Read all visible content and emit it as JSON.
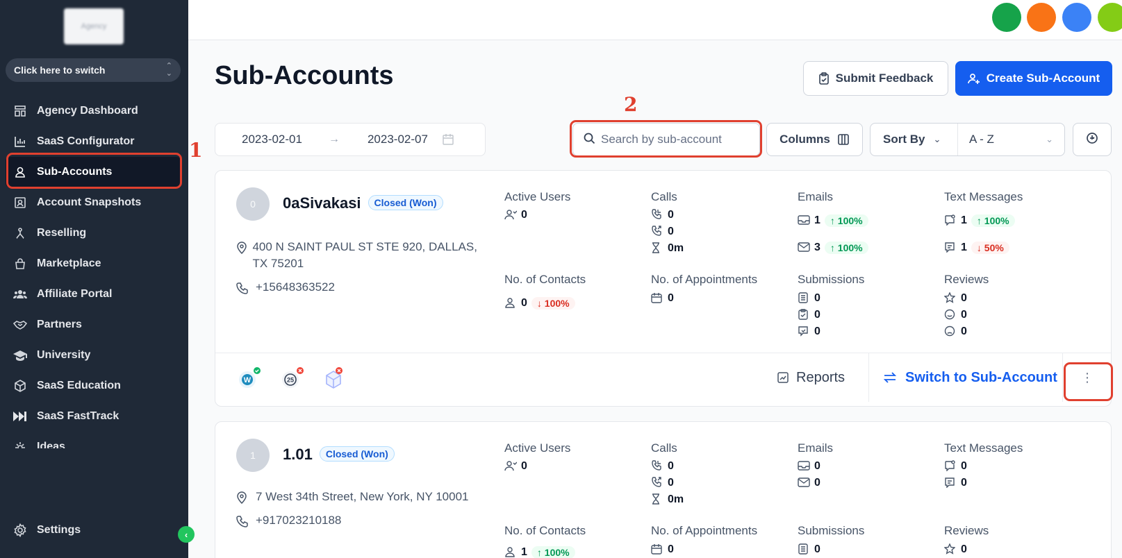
{
  "sidebar": {
    "logo_text": "Agency",
    "switcher_label": "Click here to switch",
    "items": [
      {
        "label": "Agency Dashboard",
        "icon": "dashboard-icon"
      },
      {
        "label": "SaaS Configurator",
        "icon": "chart-icon"
      },
      {
        "label": "Sub-Accounts",
        "icon": "user-icon",
        "active": true
      },
      {
        "label": "Account Snapshots",
        "icon": "snapshot-icon"
      },
      {
        "label": "Reselling",
        "icon": "reselling-icon"
      },
      {
        "label": "Marketplace",
        "icon": "bag-icon"
      },
      {
        "label": "Affiliate Portal",
        "icon": "users-icon"
      },
      {
        "label": "Partners",
        "icon": "handshake-icon"
      },
      {
        "label": "University",
        "icon": "graduation-icon"
      },
      {
        "label": "SaaS Education",
        "icon": "cube-icon"
      },
      {
        "label": "SaaS FastTrack",
        "icon": "fast-forward-icon"
      },
      {
        "label": "Ideas",
        "icon": "bulb-icon"
      }
    ],
    "settings_label": "Settings"
  },
  "annotations": {
    "one": "1",
    "two": "2"
  },
  "header": {
    "title": "Sub-Accounts",
    "submit_feedback": "Submit Feedback",
    "create_sub_account": "Create Sub-Account"
  },
  "toolbar": {
    "date_from": "2023-02-01",
    "date_to": "2023-02-07",
    "search_placeholder": "Search by sub-account",
    "columns_label": "Columns",
    "sort_by_label": "Sort By",
    "sort_value": "A - Z"
  },
  "labels": {
    "active_users": "Active Users",
    "calls": "Calls",
    "emails": "Emails",
    "text_messages": "Text Messages",
    "contacts": "No. of Contacts",
    "appointments": "No. of Appointments",
    "submissions": "Submissions",
    "reviews": "Reviews"
  },
  "accounts": [
    {
      "initial": "0",
      "name": "0aSivakasi",
      "status": "Closed (Won)",
      "address": "400 N SAINT PAUL ST STE 920, DALLAS, TX 75201",
      "phone": "+15648363522",
      "active_users": "0",
      "calls": [
        "0",
        "0",
        "0m"
      ],
      "emails": [
        {
          "value": "1",
          "trend": "100%"
        },
        {
          "value": "3",
          "trend": "100%"
        }
      ],
      "texts": [
        {
          "value": "1",
          "trend": "100%"
        },
        {
          "value": "1",
          "trend": "50%"
        }
      ],
      "contacts": {
        "value": "0",
        "trend": "100%"
      },
      "appointments": "0",
      "submissions": [
        "0",
        "0",
        "0"
      ],
      "reviews": [
        "0",
        "0",
        "0"
      ],
      "reports_label": "Reports",
      "switch_label": "Switch to Sub-Account",
      "kebab": "⋮"
    },
    {
      "initial": "1",
      "name": "1.01",
      "status": "Closed (Won)",
      "address": "7 West 34th Street, New York, NY 10001",
      "phone": "+917023210188",
      "active_users": "0",
      "calls": [
        "0",
        "0",
        "0m"
      ],
      "emails": [
        {
          "value": "0"
        },
        {
          "value": "0"
        }
      ],
      "texts": [
        {
          "value": "0"
        },
        {
          "value": "0"
        }
      ],
      "contacts": {
        "value": "1",
        "trend": "100%"
      },
      "appointments": "0",
      "submissions": [
        "0"
      ],
      "reviews": [
        "0"
      ]
    }
  ],
  "colors": {
    "sidebar": "#1f2937",
    "primary": "#155eef",
    "annotation": "#e0402f",
    "up": "#039855",
    "down": "#d92d20"
  }
}
